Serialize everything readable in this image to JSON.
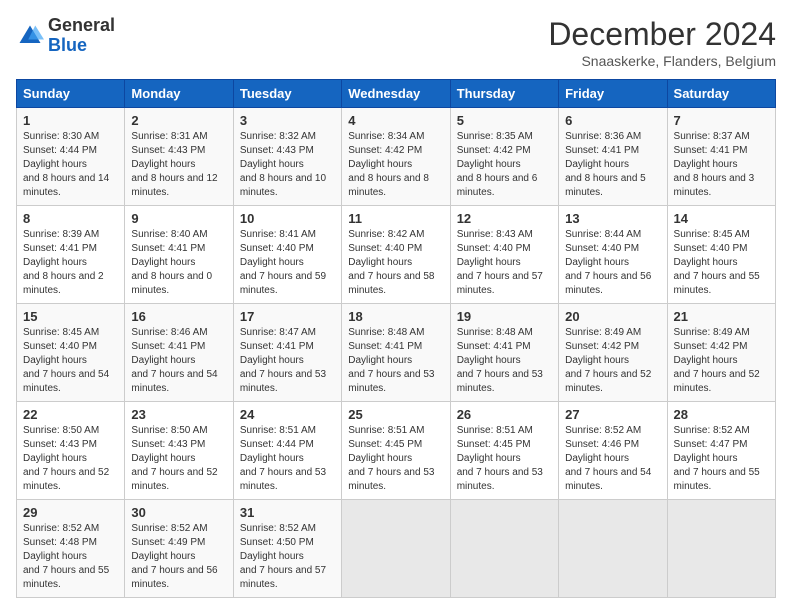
{
  "header": {
    "logo_line1": "General",
    "logo_line2": "Blue",
    "month": "December 2024",
    "location": "Snaaskerke, Flanders, Belgium"
  },
  "weekdays": [
    "Sunday",
    "Monday",
    "Tuesday",
    "Wednesday",
    "Thursday",
    "Friday",
    "Saturday"
  ],
  "weeks": [
    [
      {
        "day": "1",
        "rise": "8:30 AM",
        "set": "4:44 PM",
        "daylight": "8 hours and 14 minutes."
      },
      {
        "day": "2",
        "rise": "8:31 AM",
        "set": "4:43 PM",
        "daylight": "8 hours and 12 minutes."
      },
      {
        "day": "3",
        "rise": "8:32 AM",
        "set": "4:43 PM",
        "daylight": "8 hours and 10 minutes."
      },
      {
        "day": "4",
        "rise": "8:34 AM",
        "set": "4:42 PM",
        "daylight": "8 hours and 8 minutes."
      },
      {
        "day": "5",
        "rise": "8:35 AM",
        "set": "4:42 PM",
        "daylight": "8 hours and 6 minutes."
      },
      {
        "day": "6",
        "rise": "8:36 AM",
        "set": "4:41 PM",
        "daylight": "8 hours and 5 minutes."
      },
      {
        "day": "7",
        "rise": "8:37 AM",
        "set": "4:41 PM",
        "daylight": "8 hours and 3 minutes."
      }
    ],
    [
      {
        "day": "8",
        "rise": "8:39 AM",
        "set": "4:41 PM",
        "daylight": "8 hours and 2 minutes."
      },
      {
        "day": "9",
        "rise": "8:40 AM",
        "set": "4:41 PM",
        "daylight": "8 hours and 0 minutes."
      },
      {
        "day": "10",
        "rise": "8:41 AM",
        "set": "4:40 PM",
        "daylight": "7 hours and 59 minutes."
      },
      {
        "day": "11",
        "rise": "8:42 AM",
        "set": "4:40 PM",
        "daylight": "7 hours and 58 minutes."
      },
      {
        "day": "12",
        "rise": "8:43 AM",
        "set": "4:40 PM",
        "daylight": "7 hours and 57 minutes."
      },
      {
        "day": "13",
        "rise": "8:44 AM",
        "set": "4:40 PM",
        "daylight": "7 hours and 56 minutes."
      },
      {
        "day": "14",
        "rise": "8:45 AM",
        "set": "4:40 PM",
        "daylight": "7 hours and 55 minutes."
      }
    ],
    [
      {
        "day": "15",
        "rise": "8:45 AM",
        "set": "4:40 PM",
        "daylight": "7 hours and 54 minutes."
      },
      {
        "day": "16",
        "rise": "8:46 AM",
        "set": "4:41 PM",
        "daylight": "7 hours and 54 minutes."
      },
      {
        "day": "17",
        "rise": "8:47 AM",
        "set": "4:41 PM",
        "daylight": "7 hours and 53 minutes."
      },
      {
        "day": "18",
        "rise": "8:48 AM",
        "set": "4:41 PM",
        "daylight": "7 hours and 53 minutes."
      },
      {
        "day": "19",
        "rise": "8:48 AM",
        "set": "4:41 PM",
        "daylight": "7 hours and 53 minutes."
      },
      {
        "day": "20",
        "rise": "8:49 AM",
        "set": "4:42 PM",
        "daylight": "7 hours and 52 minutes."
      },
      {
        "day": "21",
        "rise": "8:49 AM",
        "set": "4:42 PM",
        "daylight": "7 hours and 52 minutes."
      }
    ],
    [
      {
        "day": "22",
        "rise": "8:50 AM",
        "set": "4:43 PM",
        "daylight": "7 hours and 52 minutes."
      },
      {
        "day": "23",
        "rise": "8:50 AM",
        "set": "4:43 PM",
        "daylight": "7 hours and 52 minutes."
      },
      {
        "day": "24",
        "rise": "8:51 AM",
        "set": "4:44 PM",
        "daylight": "7 hours and 53 minutes."
      },
      {
        "day": "25",
        "rise": "8:51 AM",
        "set": "4:45 PM",
        "daylight": "7 hours and 53 minutes."
      },
      {
        "day": "26",
        "rise": "8:51 AM",
        "set": "4:45 PM",
        "daylight": "7 hours and 53 minutes."
      },
      {
        "day": "27",
        "rise": "8:52 AM",
        "set": "4:46 PM",
        "daylight": "7 hours and 54 minutes."
      },
      {
        "day": "28",
        "rise": "8:52 AM",
        "set": "4:47 PM",
        "daylight": "7 hours and 55 minutes."
      }
    ],
    [
      {
        "day": "29",
        "rise": "8:52 AM",
        "set": "4:48 PM",
        "daylight": "7 hours and 55 minutes."
      },
      {
        "day": "30",
        "rise": "8:52 AM",
        "set": "4:49 PM",
        "daylight": "7 hours and 56 minutes."
      },
      {
        "day": "31",
        "rise": "8:52 AM",
        "set": "4:50 PM",
        "daylight": "7 hours and 57 minutes."
      },
      null,
      null,
      null,
      null
    ]
  ]
}
